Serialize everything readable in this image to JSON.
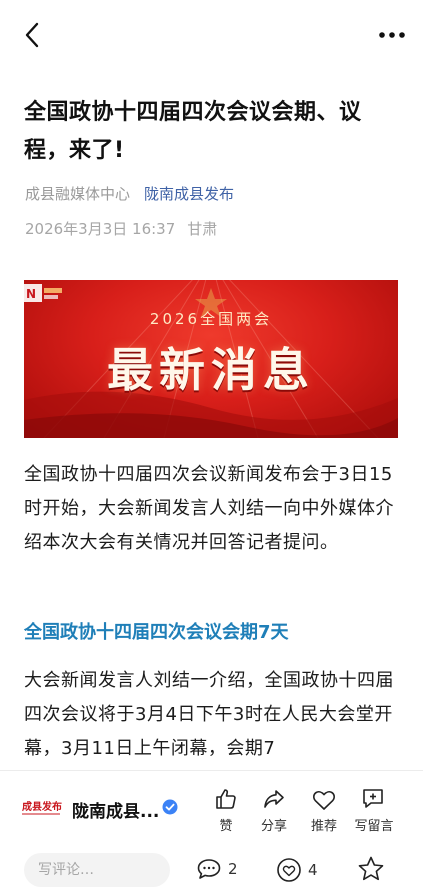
{
  "article": {
    "title": "全国政协十四届四次会议会期、议程，来了!",
    "source": "成县融媒体中心",
    "publisher": "陇南成县发布",
    "datetime": "2026年3月3日 16:37",
    "location": "甘肃"
  },
  "banner": {
    "subtitle": "2026全国两会",
    "headline": "最新消息"
  },
  "body": {
    "para1": "全国政协十四届四次会议新闻发布会于3日15时开始，大会新闻发言人刘结一向中外媒体介绍本次大会有关情况并回答记者提问。",
    "subheading": "全国政协十四届四次会议会期7天",
    "para2": "大会新闻发言人刘结一介绍，全国政协十四届四次会议将于3月4日下午3时在人民大会堂开幕，3月11日上午闭幕，会期7"
  },
  "footer": {
    "account_name": "陇南成县...",
    "actions": {
      "like": "赞",
      "share": "分享",
      "recommend": "推荐",
      "write": "写留言"
    },
    "comment_placeholder": "写评论…",
    "comment_count": "2",
    "like_count": "4"
  },
  "colors": {
    "accent_blue": "#1f7fb8",
    "publisher_blue": "#3f62a6",
    "banner_red": "#d81f1a"
  },
  "icons": [
    "back-chevron-icon",
    "more-dots-icon",
    "thumbs-up-icon",
    "share-arrow-icon",
    "heart-icon",
    "write-comment-icon",
    "comment-bubble-icon",
    "like-circle-icon",
    "star-icon",
    "verified-badge-icon"
  ]
}
